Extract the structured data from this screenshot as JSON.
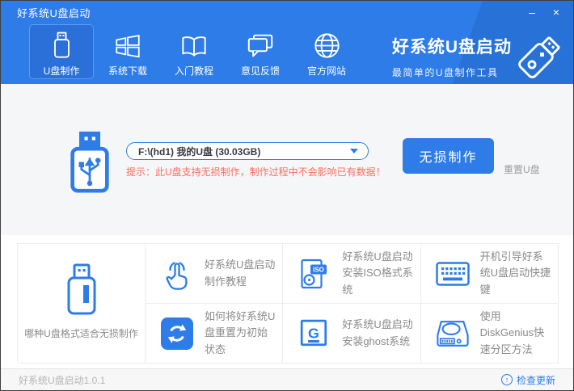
{
  "colors": {
    "primary_blue": "#2d7ce8",
    "active_nav_blue": "#2b6fd8",
    "main_bg_gray": "#f5f6f8",
    "tip_red": "#fa6e5f",
    "label_gray": "#8a8a8a"
  },
  "window": {
    "title": "好系统U盘启动",
    "minimize_label": "–",
    "close_label": "×"
  },
  "nav": {
    "items": [
      {
        "label": "U盘制作",
        "icon": "usb-drive-icon",
        "active": true
      },
      {
        "label": "系统下载",
        "icon": "windows-icon",
        "active": false
      },
      {
        "label": "入门教程",
        "icon": "book-icon",
        "active": false
      },
      {
        "label": "意见反馈",
        "icon": "feedback-icon",
        "active": false
      },
      {
        "label": "官方网站",
        "icon": "globe-icon",
        "active": false
      }
    ],
    "brand": {
      "title": "好系统U盘启动",
      "subtitle": "最简单的U盘制作工具",
      "icon": "usb-stick-icon"
    }
  },
  "main": {
    "drive_icon": "usb-flash-icon",
    "drive_select_value": "F:\\(hd1) 我的U盘 (30.03GB)",
    "tip": "提示：此U盘支持无损制作，制作过程中不会影响已有数据！",
    "make_button_label": "无损制作",
    "reset_link_label": "重置U盘"
  },
  "shortcuts": {
    "featured": {
      "label": "哪种U盘格式适合无损制作",
      "icon": "usb-drive-icon"
    },
    "items": [
      {
        "label": "好系统U盘启动制作教程",
        "icon": "click-hand-icon"
      },
      {
        "label": "好系统U盘启动安装ISO格式系统",
        "icon": "iso-file-icon",
        "badge": "ISO"
      },
      {
        "label": "开机引导好系统U盘启动快捷键",
        "icon": "keyboard-icon"
      },
      {
        "label": "如何将好系统U盘重置为初始状态",
        "icon": "refresh-icon"
      },
      {
        "label": "好系统U盘启动安装ghost系统",
        "icon": "ghost-g-icon",
        "glyph": "G"
      },
      {
        "label": "使用DiskGenius快速分区方法",
        "icon": "disk-icon"
      }
    ]
  },
  "statusbar": {
    "version": "好系统U盘启动1.0.1",
    "update_label": "检查更新",
    "update_icon_glyph": "↑"
  }
}
